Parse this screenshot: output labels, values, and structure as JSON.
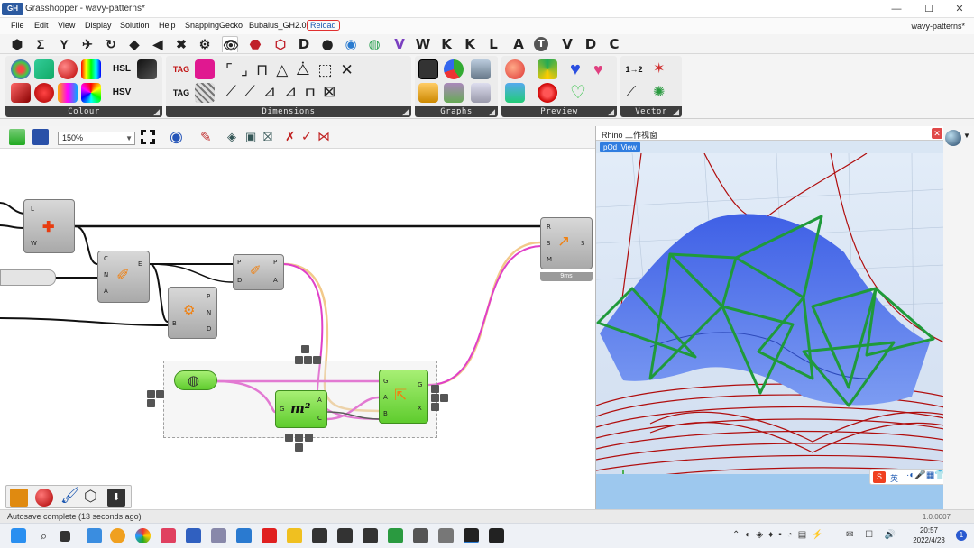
{
  "window": {
    "logo_text": "GH",
    "title": "Grasshopper - wavy-patterns*",
    "min": "—",
    "max": "☐",
    "close": "✕",
    "document_name": "wavy-patterns*"
  },
  "menu": {
    "items": [
      "File",
      "Edit",
      "View",
      "Display",
      "Solution",
      "Help",
      "SnappingGecko",
      "Bubalus_GH2.0"
    ],
    "reload": "Reload"
  },
  "tabs": {
    "symbols": [
      "⬢",
      "Σ",
      "Y",
      "✈",
      "↻",
      "◆",
      "◀",
      "✖",
      "⚙",
      "👁",
      "⬣",
      "⬡"
    ],
    "letters": [
      "D",
      "●",
      "◉",
      "◍",
      "V",
      "W",
      "K",
      "K",
      "L",
      "A",
      "T",
      "V",
      "D",
      "C"
    ]
  },
  "ribbon": {
    "groups": [
      {
        "label": "Colour"
      },
      {
        "label": "Dimensions"
      },
      {
        "label": "Graphs"
      },
      {
        "label": "Preview"
      },
      {
        "label": "Vector"
      }
    ],
    "hsl": "HSL",
    "hsv": "HSV",
    "tag": "TAG",
    "tag2": "TAG",
    "vec_label": "1→2"
  },
  "canvas_toolbar": {
    "zoom": "150%"
  },
  "components": {
    "c1": {
      "inputs": [
        "L",
        "",
        "W"
      ],
      "outputs": []
    },
    "c2": {
      "inputs": [
        "C",
        "N",
        "A"
      ],
      "outputs": [
        "E"
      ]
    },
    "c3": {
      "inputs": [
        "P",
        "D"
      ],
      "outputs": [
        "P",
        "A"
      ]
    },
    "c4": {
      "inputs": [
        "B"
      ],
      "outputs": [
        "P",
        "N",
        "D"
      ]
    },
    "c5": {
      "inputs": [
        "R",
        "S",
        "M"
      ],
      "outputs": [
        "S"
      ],
      "badge": "9ms"
    },
    "c6": {
      "inputs": [
        "G",
        "A",
        "B"
      ],
      "outputs": [
        "G",
        "X"
      ]
    },
    "area": {
      "inputs": [
        "G"
      ],
      "outputs": [
        "A",
        "C"
      ],
      "glyph": "m²"
    }
  },
  "rhino": {
    "title": "Rhino 工作视窗",
    "close": "✕",
    "viewport_tab": "pOd_View",
    "axis_x": "X",
    "axis_z": "Z",
    "ime": "英"
  },
  "status": {
    "message": "Autosave complete (13 seconds ago)",
    "version": "1.0.0007"
  },
  "taskbar": {
    "time": "20:57",
    "date": "2022/4/23"
  },
  "colors": {
    "grass_green": "#5fcc2e",
    "wire_pink": "#e040c8",
    "wire_orange": "#f2c98a",
    "surface_blue": "#4d6fe8",
    "pattern_green": "#1f9a3a",
    "contour_red": "#b00d0d"
  }
}
